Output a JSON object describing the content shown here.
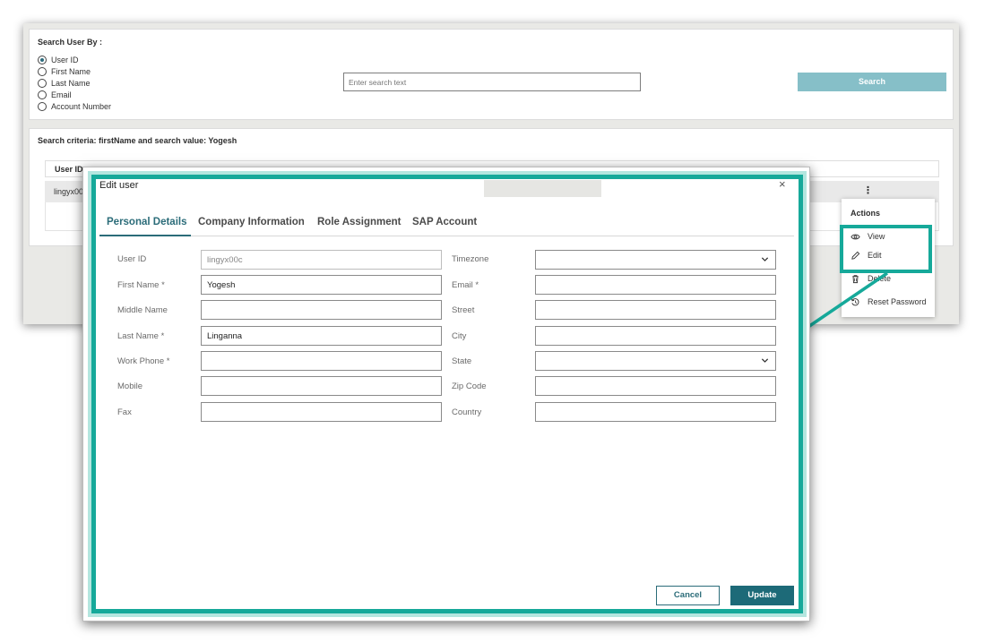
{
  "search": {
    "title": "Search User By :",
    "options": [
      "User ID",
      "First Name",
      "Last Name",
      "Email",
      "Account Number"
    ],
    "selected": "User ID",
    "placeholder": "Enter search text",
    "button_label": "Search"
  },
  "results": {
    "criteria": "Search criteria: firstName and search value: Yogesh",
    "column_userid": "User ID",
    "row_userid": "lingyx00",
    "kebab": "⋮"
  },
  "actions_menu": {
    "title": "Actions",
    "items": [
      {
        "label": "View",
        "icon": "eye-icon"
      },
      {
        "label": "Edit",
        "icon": "pencil-icon"
      },
      {
        "label": "Delete",
        "icon": "trash-icon"
      },
      {
        "label": "Reset Password",
        "icon": "reset-icon"
      }
    ]
  },
  "modal": {
    "title": "Edit user",
    "close": "×",
    "tabs": [
      "Personal Details",
      "Company Information",
      "Role Assignment",
      "SAP Account"
    ],
    "active_tab": "Personal Details",
    "left_fields": [
      {
        "label": "User ID",
        "value": "lingyx00c"
      },
      {
        "label": "First Name *",
        "value": "Yogesh"
      },
      {
        "label": "Middle Name",
        "value": ""
      },
      {
        "label": "Last Name *",
        "value": "Linganna"
      },
      {
        "label": "Work Phone *",
        "value": ""
      },
      {
        "label": "Mobile",
        "value": ""
      },
      {
        "label": "Fax",
        "value": ""
      }
    ],
    "right_fields": [
      {
        "label": "Timezone",
        "value": ""
      },
      {
        "label": "Email *",
        "value": ""
      },
      {
        "label": "Street",
        "value": ""
      },
      {
        "label": "City",
        "value": ""
      },
      {
        "label": "State",
        "value": ""
      },
      {
        "label": "Zip Code",
        "value": ""
      },
      {
        "label": "Country",
        "value": ""
      }
    ],
    "cancel_label": "Cancel",
    "update_label": "Update"
  },
  "colors": {
    "accent": "#16a99a",
    "primary": "#1d6a78",
    "search_button": "#86bfc8"
  }
}
